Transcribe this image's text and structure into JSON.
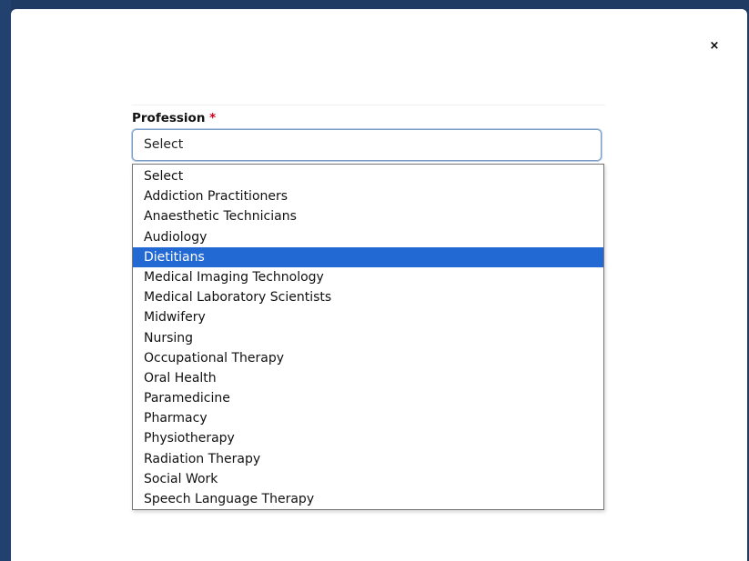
{
  "dialog": {
    "close_glyph": "×"
  },
  "field": {
    "label": "Profession",
    "required_mark": "*",
    "current_value": "Select"
  },
  "dropdown": {
    "highlighted_index": 4,
    "options": [
      "Select",
      "Addiction Practitioners",
      "Anaesthetic Technicians",
      "Audiology",
      "Dietitians",
      "Medical Imaging Technology",
      "Medical Laboratory Scientists",
      "Midwifery",
      "Nursing",
      "Occupational Therapy",
      "Oral Health",
      "Paramedicine",
      "Pharmacy",
      "Physiotherapy",
      "Radiation Therapy",
      "Social Work",
      "Speech Language Therapy"
    ]
  },
  "colors": {
    "highlight": "#2369d4",
    "required": "#d0021b",
    "backdrop": "#1f3a63"
  }
}
